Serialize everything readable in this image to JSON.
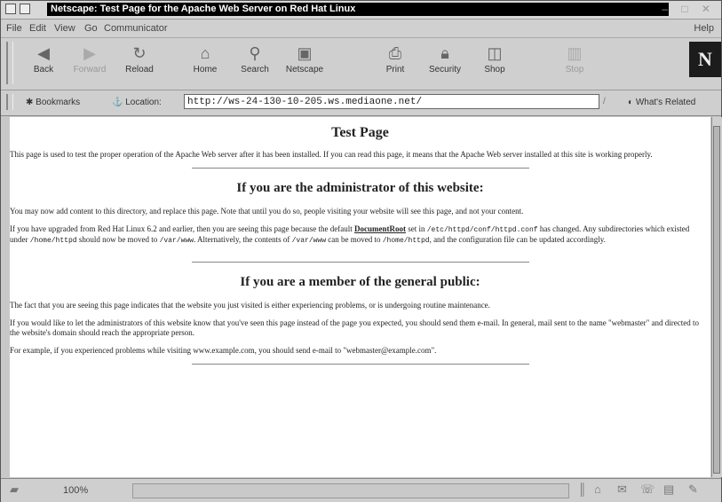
{
  "window": {
    "title": "Netscape: Test Page for the Apache Web Server on Red Hat Linux"
  },
  "menu": [
    "File",
    "Edit",
    "View",
    "Go",
    "Communicator",
    "Help"
  ],
  "toolbar": {
    "back": "Back",
    "forward": "Forward",
    "reload": "Reload",
    "home": "Home",
    "search": "Search",
    "netscape": "Netscape",
    "print": "Print",
    "security": "Security",
    "shop": "Shop",
    "stop": "Stop",
    "logo": "N"
  },
  "locationbar": {
    "bookmarks": "Bookmarks",
    "location_label": "Location:",
    "url": "http://ws-24-130-10-205.ws.mediaone.net/",
    "whats_related": "What's Related"
  },
  "page": {
    "title": "Test Page",
    "intro": "This page is used to test the proper operation of the Apache Web server after it has been installed. If you can read this page, it means that the Apache Web server installed at this site is working properly.",
    "admin_heading": "If you are the administrator of this website:",
    "admin_p1": "You may now add content to this directory, and replace this page. Note that until you do so, people visiting your website will see this page, and not your content.",
    "admin_p2_a": "If you have upgraded from Red Hat Linux 6.2 and earlier, then you are seeing this page because the default",
    "admin_p2_link": "DocumentRoot",
    "admin_p2_b": "set in",
    "admin_p2_code1": "/etc/httpd/conf/httpd.conf",
    "admin_p2_c": "has changed. Any subdirectories which existed under",
    "admin_p2_code2": "/home/httpd",
    "admin_p2_d": "should now be moved to",
    "admin_p2_code3": "/var/www",
    "admin_p2_e": ". Alternatively, the contents of",
    "admin_p2_code4": "/var/www",
    "admin_p2_f": "can be moved to",
    "admin_p2_code5": "/home/httpd",
    "admin_p2_g": ", and the configuration file can be updated accordingly.",
    "public_heading": "If you are a member of the general public:",
    "public_p1": "The fact that you are seeing this page indicates that the website you just visited is either experiencing problems, or is undergoing routine maintenance.",
    "public_p2": "If you would like to let the administrators of this website know that you've seen this page instead of the page you expected, you should send them e-mail. In general, mail sent to the name \"webmaster\" and directed to the website's domain should reach the appropriate person.",
    "public_p3": "For example, if you experienced problems while visiting www.example.com, you should send e-mail to \"webmaster@example.com\"."
  },
  "status": {
    "percent": "100%"
  }
}
